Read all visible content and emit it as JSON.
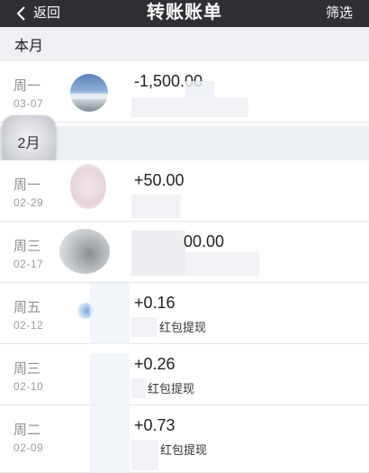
{
  "nav": {
    "back_label": "返回",
    "title": "转账账单",
    "filter_label": "筛选"
  },
  "sections": {
    "current_month": "本月",
    "february": "2月"
  },
  "month_bubble": "2月",
  "rows": [
    {
      "day": "周一",
      "date": "03-07",
      "amount": "-1,500.00",
      "description": ""
    },
    {
      "day": "周一",
      "date": "02-29",
      "amount": "+50.00",
      "description": ""
    },
    {
      "day": "周三",
      "date": "02-17",
      "amount": "00.00",
      "description": ""
    },
    {
      "day": "周五",
      "date": "02-12",
      "amount": "+0.16",
      "description": "红包提现"
    },
    {
      "day": "周三",
      "date": "02-10",
      "amount": "+0.26",
      "description": "红包提现"
    },
    {
      "day": "周二",
      "date": "02-09",
      "amount": "+0.73",
      "description": "红包提现"
    }
  ],
  "colors": {
    "navbar": "#2e2f33",
    "section_bg": "#efeff4",
    "secondary_text": "#8e8e93"
  },
  "icons": {
    "back": "chevron-left-icon"
  }
}
